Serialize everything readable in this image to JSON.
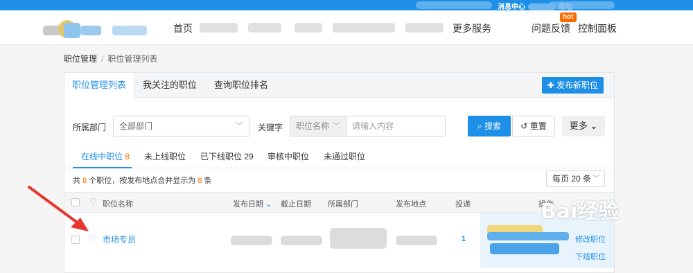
{
  "topbar": {
    "messages": "消息中心",
    "help": "帮助"
  },
  "nav": {
    "home": "首页",
    "more_services": "更多服务",
    "feedback": "问题反馈",
    "hot_badge": "hot",
    "control_panel": "控制面板"
  },
  "breadcrumb": {
    "root": "职位管理",
    "separator": "/",
    "current": "职位管理列表"
  },
  "tabs": [
    {
      "label": "职位管理列表"
    },
    {
      "label": "我关注的职位"
    },
    {
      "label": "查询职位排名"
    }
  ],
  "publish_button": "发布新职位",
  "filters": {
    "dept_label": "所属部门",
    "dept_value": "全部部门",
    "keyword_label": "关键字",
    "keyword_type": "职位名称",
    "keyword_placeholder": "请输入内容",
    "search": "搜索",
    "reset": "重置",
    "more": "更多"
  },
  "status_tabs": [
    {
      "label": "在线中职位",
      "count": "8"
    },
    {
      "label": "未上线职位",
      "count": ""
    },
    {
      "label": "已下线职位",
      "count": "29"
    },
    {
      "label": "审核中职位",
      "count": ""
    },
    {
      "label": "未通过职位",
      "count": ""
    }
  ],
  "summary": {
    "prefix": "共",
    "total": "8",
    "mid": "个职位，按发布地点合并显示为",
    "merged": "8",
    "suffix": "条"
  },
  "per_page": "每页 20 条",
  "table": {
    "headers": {
      "name": "职位名称",
      "publish_date": "发布日期",
      "end_date": "截止日期",
      "dept": "所属部门",
      "location": "发布地点",
      "delivery": "投递",
      "actions": "操作"
    },
    "rows": [
      {
        "name": "市场专员",
        "delivery": "1",
        "action_edit": "修改职位",
        "action_offline": "下线职位"
      }
    ]
  },
  "watermark": "Bai经验",
  "colors": {
    "accent": "#1e8fe6",
    "topbar": "#1e8fe6",
    "highlight": "#ff6a00",
    "arrow": "#e8352e"
  }
}
